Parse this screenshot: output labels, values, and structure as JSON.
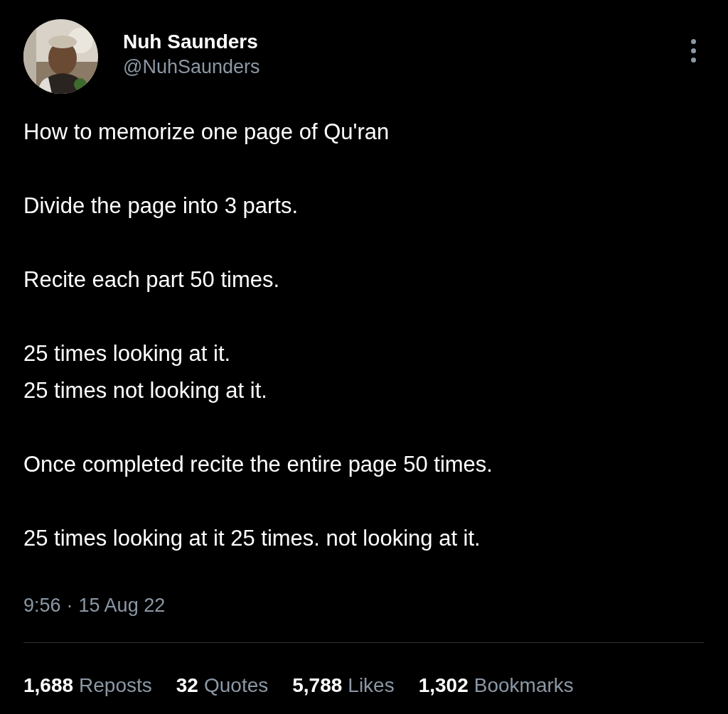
{
  "author": {
    "name": "Nuh Saunders",
    "handle": "@NuhSaunders"
  },
  "post": {
    "paragraphs": [
      [
        "How to memorize one page of Qu'ran"
      ],
      [
        "Divide the page into 3 parts."
      ],
      [
        "Recite each part 50 times."
      ],
      [
        "25 times looking at it.",
        "25 times not looking at it."
      ],
      [
        "Once completed recite the entire page 50 times."
      ],
      [
        "25 times looking at it 25 times. not looking at it."
      ]
    ],
    "time": "9:56",
    "separator": "·",
    "date": "15 Aug 22"
  },
  "stats": [
    {
      "count": "1,688",
      "label": "Reposts"
    },
    {
      "count": "32",
      "label": "Quotes"
    },
    {
      "count": "5,788",
      "label": "Likes"
    },
    {
      "count": "1,302",
      "label": "Bookmarks"
    }
  ]
}
